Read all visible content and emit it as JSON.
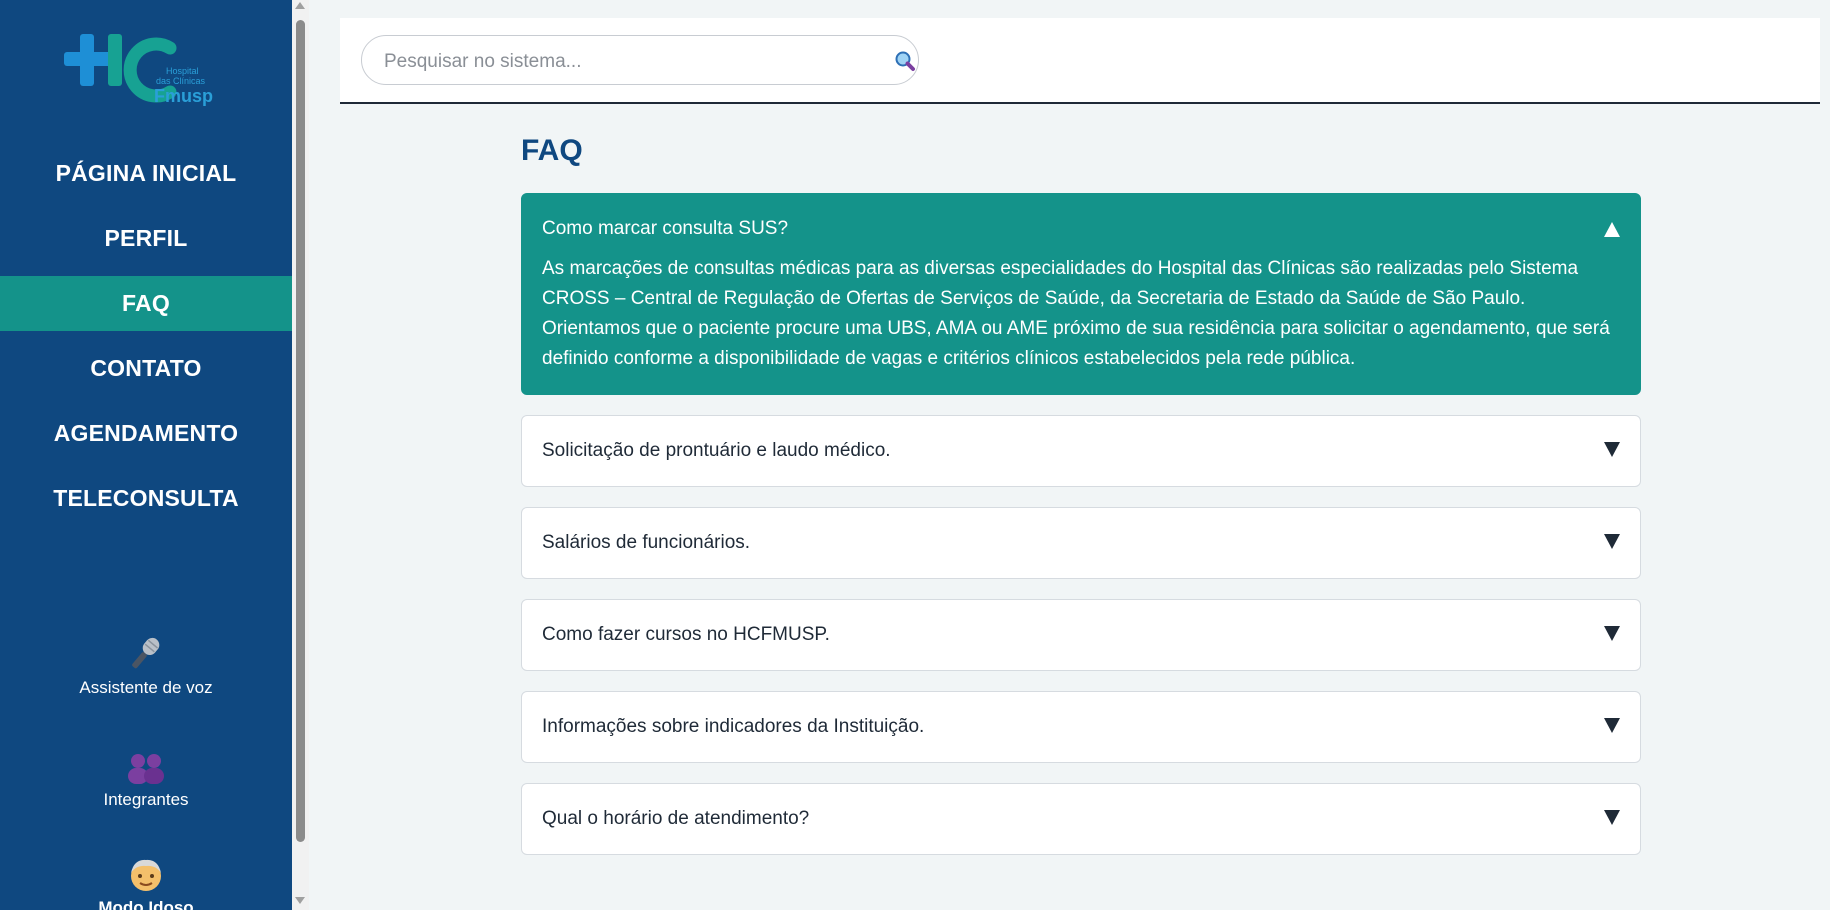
{
  "logo": {
    "small_text_1": "Hospital",
    "small_text_2": "das Clínicas",
    "name": "Fmusp"
  },
  "sidebar": {
    "nav": [
      {
        "label": "PÁGINA INICIAL"
      },
      {
        "label": "PERFIL"
      },
      {
        "label": "FAQ"
      },
      {
        "label": "CONTATO"
      },
      {
        "label": "AGENDAMENTO"
      },
      {
        "label": "TELECONSULTA"
      }
    ],
    "active": "FAQ",
    "tools": {
      "voice": {
        "label": "Assistente de voz",
        "icon": "microphone-icon"
      },
      "members": {
        "label": "Integrantes",
        "icon": "people-icon"
      },
      "elder": {
        "label": "Modo Idoso",
        "icon": "older-person-icon"
      }
    }
  },
  "search": {
    "placeholder": "Pesquisar no sistema...",
    "value": "",
    "icon": "search-icon"
  },
  "page": {
    "title": "FAQ"
  },
  "faq": {
    "items": [
      {
        "question": "Como marcar consulta SUS?",
        "expanded": true,
        "answer": "As marcações de consultas médicas para as diversas especialidades do Hospital das Clínicas são realizadas pelo Sistema CROSS – Central de Regulação de Ofertas de Serviços de Saúde, da Secretaria de Estado da Saúde de São Paulo. Orientamos que o paciente procure uma UBS, AMA ou AME próximo de sua residência para solicitar o agendamento, que será definido conforme a disponibilidade de vagas e critérios clínicos estabelecidos pela rede pública."
      },
      {
        "question": "Solicitação de prontuário e laudo médico.",
        "expanded": false
      },
      {
        "question": "Salários de funcionários.",
        "expanded": false
      },
      {
        "question": "Como fazer cursos no HCFMUSP.",
        "expanded": false
      },
      {
        "question": "Informações sobre indicadores da Instituição.",
        "expanded": false
      },
      {
        "question": "Qual o horário de atendimento?",
        "expanded": false
      }
    ]
  },
  "colors": {
    "sidebar": "#0f4880",
    "accent": "#14938a",
    "title": "#0f4880"
  }
}
